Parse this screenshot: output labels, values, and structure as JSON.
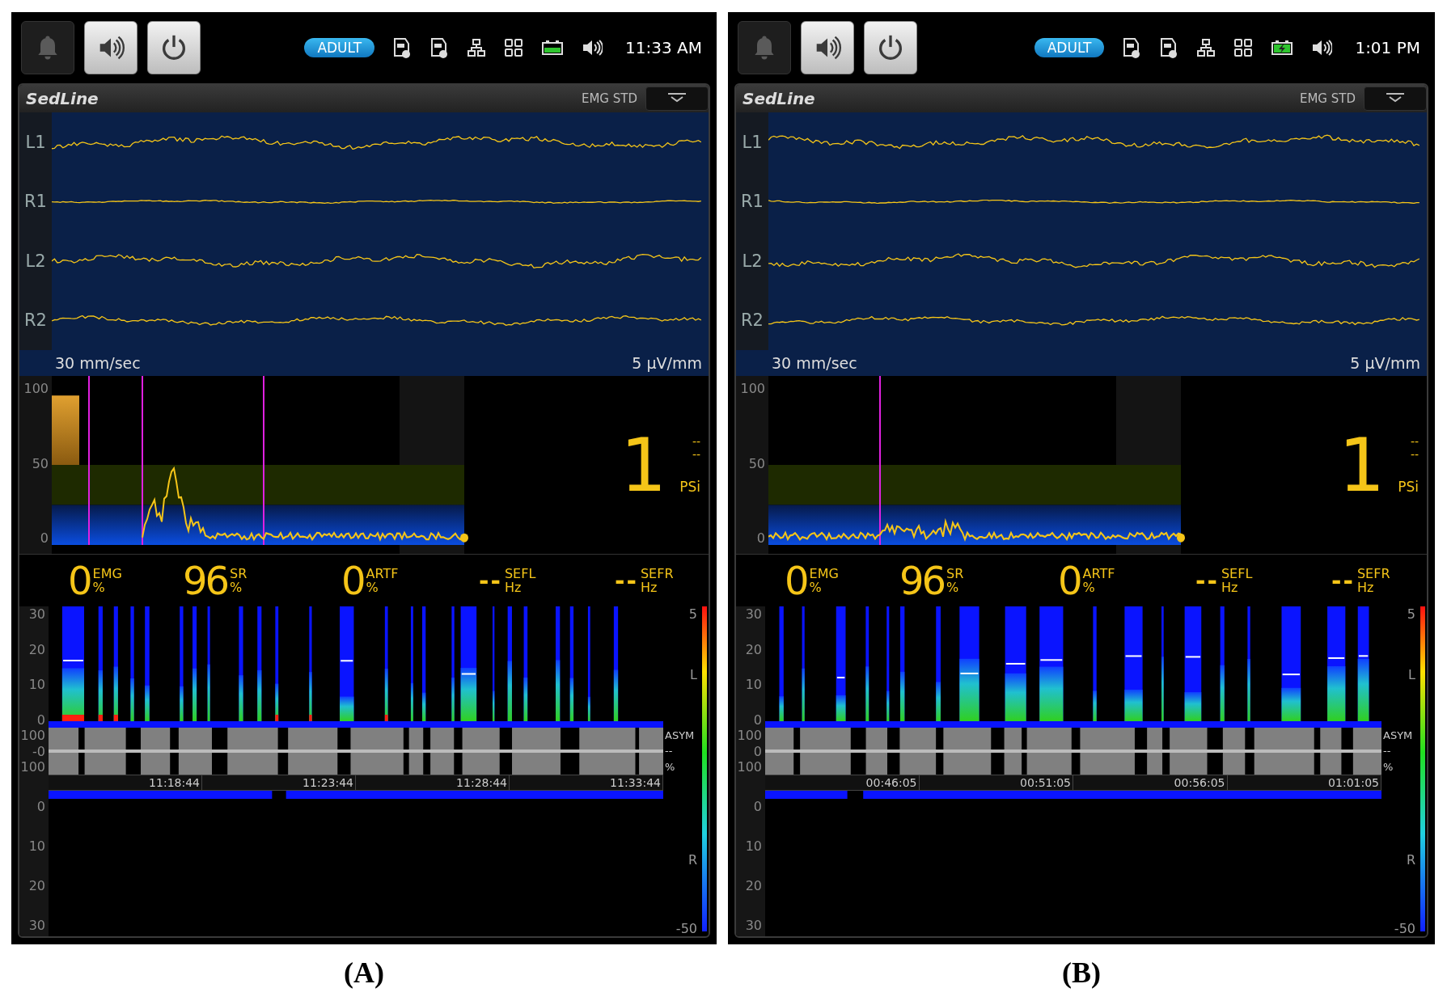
{
  "panels": [
    {
      "caption": "(A)",
      "top_bar": {
        "buttons": [
          {
            "kind": "alarm",
            "disabled": true
          },
          {
            "kind": "audio",
            "disabled": false
          },
          {
            "kind": "power",
            "disabled": false
          }
        ],
        "mode_badge": "ADULT",
        "battery_charging": false,
        "time": "11:33 AM"
      },
      "module": {
        "title": "SedLine",
        "mode": "EMG STD"
      },
      "waveforms": {
        "channels": [
          "L1",
          "R1",
          "L2",
          "R2"
        ],
        "speed": "30 mm/sec",
        "scale": "5 μV/mm"
      },
      "psi_trend": {
        "yticks": [
          "100",
          "50",
          "0"
        ]
      },
      "psi": {
        "value": "1",
        "upper": "--",
        "lower": "--",
        "label": "PSi"
      },
      "parameters": [
        {
          "value": "0",
          "name": "EMG",
          "unit": "%"
        },
        {
          "value": "96",
          "name": "SR",
          "unit": "%"
        },
        {
          "value": "0",
          "name": "ARTF",
          "unit": "%"
        },
        {
          "value": "--",
          "name": "SEFL",
          "unit": "Hz"
        },
        {
          "value": "--",
          "name": "SEFR",
          "unit": "Hz"
        }
      ],
      "dsa": {
        "left_ticks": [
          "30",
          "20",
          "10",
          "0"
        ],
        "asym_ticks": [
          "100",
          "-0",
          "100"
        ],
        "right_ticks": [
          "0",
          "10",
          "20",
          "30"
        ],
        "left_label": "L",
        "right_label": "R",
        "asym_label": "ASYM",
        "asym_value": "--",
        "asym_unit": "%",
        "scale_max": "5",
        "scale_min": "-50",
        "times": [
          "11:18:44",
          "11:23:44",
          "11:28:44",
          "11:33:44"
        ]
      }
    },
    {
      "caption": "(B)",
      "top_bar": {
        "buttons": [
          {
            "kind": "alarm",
            "disabled": true
          },
          {
            "kind": "audio",
            "disabled": false
          },
          {
            "kind": "power",
            "disabled": false
          }
        ],
        "mode_badge": "ADULT",
        "battery_charging": true,
        "time": "1:01 PM"
      },
      "module": {
        "title": "SedLine",
        "mode": "EMG STD"
      },
      "waveforms": {
        "channels": [
          "L1",
          "R1",
          "L2",
          "R2"
        ],
        "speed": "30 mm/sec",
        "scale": "5 μV/mm"
      },
      "psi_trend": {
        "yticks": [
          "100",
          "50",
          "0"
        ]
      },
      "psi": {
        "value": "1",
        "upper": "--",
        "lower": "--",
        "label": "PSi"
      },
      "parameters": [
        {
          "value": "0",
          "name": "EMG",
          "unit": "%"
        },
        {
          "value": "96",
          "name": "SR",
          "unit": "%"
        },
        {
          "value": "0",
          "name": "ARTF",
          "unit": "%"
        },
        {
          "value": "--",
          "name": "SEFL",
          "unit": "Hz"
        },
        {
          "value": "--",
          "name": "SEFR",
          "unit": "Hz"
        }
      ],
      "dsa": {
        "left_ticks": [
          "30",
          "20",
          "10",
          "0"
        ],
        "asym_ticks": [
          "100",
          "0",
          "100"
        ],
        "right_ticks": [
          "0",
          "10",
          "20",
          "30"
        ],
        "left_label": "L",
        "right_label": "R",
        "asym_label": "ASYM",
        "asym_value": "--",
        "asym_unit": "%",
        "scale_max": "5",
        "scale_min": "-50",
        "times": [
          "00:46:05",
          "00:51:05",
          "00:56:05",
          "01:01:05"
        ]
      }
    }
  ]
}
